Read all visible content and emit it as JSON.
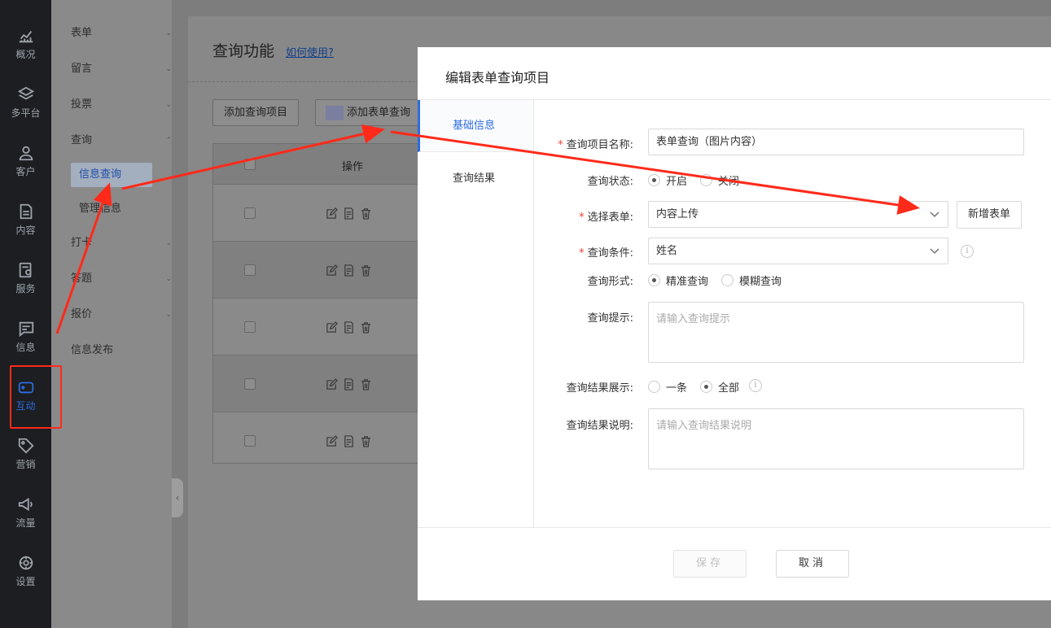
{
  "nav": {
    "items": [
      {
        "label": "概况",
        "icon": "chart-icon"
      },
      {
        "label": "多平台",
        "icon": "layers-icon"
      },
      {
        "label": "客户",
        "icon": "user-icon"
      },
      {
        "label": "内容",
        "icon": "document-icon"
      },
      {
        "label": "服务",
        "icon": "service-icon"
      },
      {
        "label": "信息",
        "icon": "message-icon"
      },
      {
        "label": "互动",
        "icon": "gamepad-icon"
      },
      {
        "label": "营销",
        "icon": "tag-icon"
      },
      {
        "label": "流量",
        "icon": "megaphone-icon"
      },
      {
        "label": "设置",
        "icon": "gear-icon"
      }
    ],
    "active": "互动",
    "active_color": "#2b6cde"
  },
  "submenu": {
    "items": [
      {
        "label": "表单"
      },
      {
        "label": "留言"
      },
      {
        "label": "投票"
      },
      {
        "label": "查询"
      },
      {
        "label": "打卡"
      },
      {
        "label": "答题"
      },
      {
        "label": "报价"
      },
      {
        "label": "信息发布"
      }
    ],
    "children": [
      {
        "label": "信息查询",
        "selected": true
      },
      {
        "label": "管理信息",
        "selected": false
      }
    ]
  },
  "main": {
    "title": "查询功能",
    "help_link": "如何使用?",
    "buttons": {
      "add_query_item": "添加查询项目",
      "add_form_query": "添加表单查询"
    },
    "table": {
      "operation_header": "操作",
      "row_count": 5
    }
  },
  "modal": {
    "title": "编辑表单查询项目",
    "tabs": [
      {
        "label": "基础信息",
        "active": true
      },
      {
        "label": "查询结果",
        "active": false
      }
    ],
    "fields": {
      "name_label": "查询项目名称:",
      "name_value": "表单查询（图片内容）",
      "status_label": "查询状态:",
      "status_on": "开启",
      "status_off": "关闭",
      "form_label": "选择表单:",
      "form_value": "内容上传",
      "add_form_button": "新增表单",
      "condition_label": "查询条件:",
      "condition_value": "姓名",
      "mode_label": "查询形式:",
      "mode_exact": "精准查询",
      "mode_fuzzy": "模糊查询",
      "hint_label": "查询提示:",
      "hint_placeholder": "请输入查询提示",
      "display_label": "查询结果展示:",
      "display_one": "一条",
      "display_all": "全部",
      "desc_label": "查询结果说明:",
      "desc_placeholder": "请输入查询结果说明"
    },
    "footer": {
      "save": "保存",
      "cancel": "取消"
    }
  },
  "annotation_color": "#ff2a1a"
}
